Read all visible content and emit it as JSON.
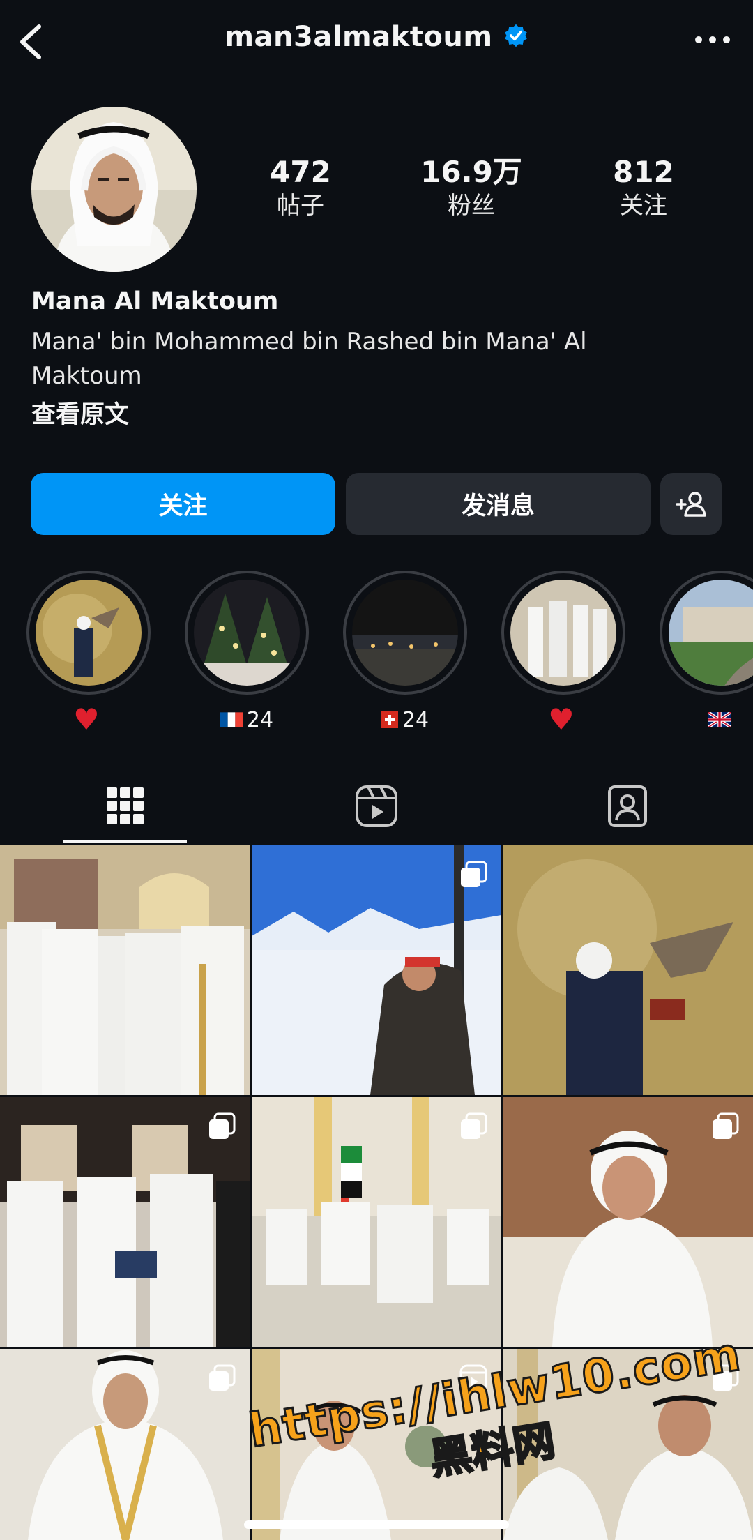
{
  "header": {
    "username": "man3almaktoum",
    "back_icon": "chevron-left-icon",
    "verified_icon": "verified-badge-icon",
    "more_icon": "more-horizontal-icon"
  },
  "stats": {
    "posts": {
      "value": "472",
      "label": "帖子"
    },
    "followers": {
      "value": "16.9万",
      "label": "粉丝"
    },
    "following": {
      "value": "812",
      "label": "关注"
    }
  },
  "profile": {
    "name": "Mana Al Maktoum",
    "bio": "Mana' bin Mohammed bin Rashed bin Mana' Al Maktoum",
    "see_translation": "查看原文"
  },
  "actions": {
    "follow_label": "关注",
    "message_label": "发消息",
    "add_user_icon": "add-person-icon"
  },
  "highlights": [
    {
      "label": "",
      "emoji": "heart"
    },
    {
      "label": "24",
      "emoji": "flag-france"
    },
    {
      "label": "24",
      "emoji": "flag-switzerland"
    },
    {
      "label": "",
      "emoji": "heart"
    },
    {
      "label": "",
      "emoji": "flag-uk"
    }
  ],
  "tabs": [
    {
      "name": "grid-tab",
      "icon": "grid-icon",
      "selected": true
    },
    {
      "name": "reels-tab",
      "icon": "reels-icon",
      "selected": false
    },
    {
      "name": "tagged-tab",
      "icon": "tagged-person-icon",
      "selected": false
    }
  ],
  "watermark": {
    "url": "https://ihlw10.com",
    "text": "黑料网"
  },
  "colors": {
    "background": "#0c0f14",
    "accent": "#0095f6",
    "secondary_button": "#262a31",
    "verified": "#0095f6",
    "watermark": "#f6a21b"
  }
}
